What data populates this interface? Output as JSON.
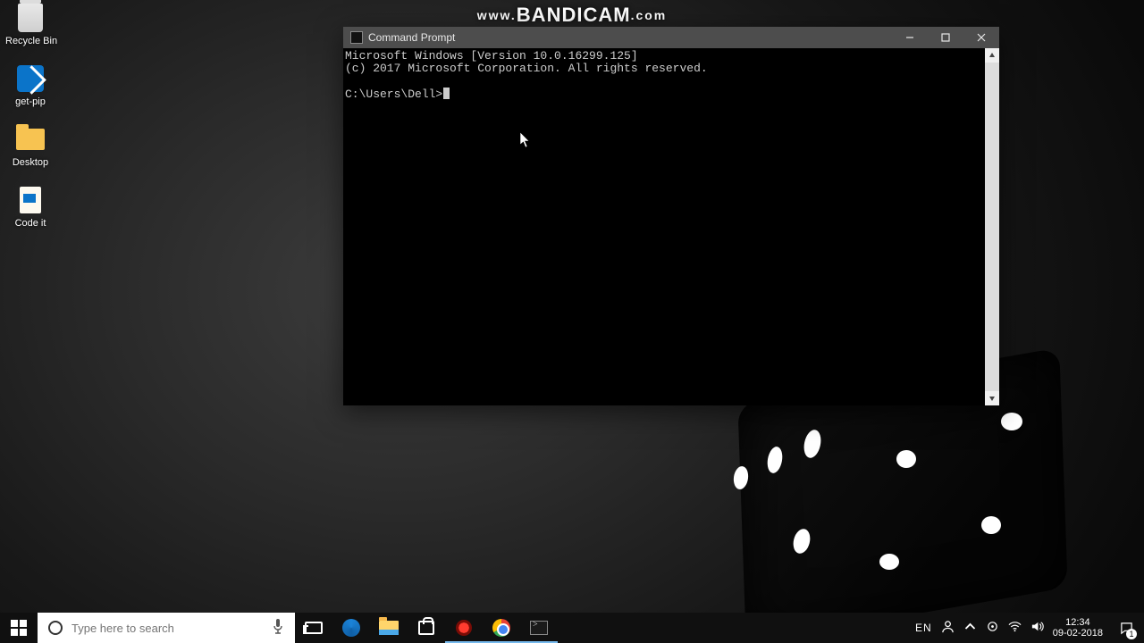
{
  "watermark": {
    "prefix": "www.",
    "brand": "BANDICAM",
    "suffix": ".com"
  },
  "desktop_icons": [
    {
      "name": "recycle-bin",
      "label": "Recycle Bin",
      "shape": "ic-bin"
    },
    {
      "name": "get-pip",
      "label": "get-pip",
      "shape": "ic-vs"
    },
    {
      "name": "desktop",
      "label": "Desktop",
      "shape": "ic-folder"
    },
    {
      "name": "code-it",
      "label": "Code it",
      "shape": "ic-file"
    }
  ],
  "cmd_window": {
    "title": "Command Prompt",
    "lines": [
      "Microsoft Windows [Version 10.0.16299.125]",
      "(c) 2017 Microsoft Corporation. All rights reserved.",
      "",
      "C:\\Users\\Dell>"
    ]
  },
  "taskbar": {
    "search_placeholder": "Type here to search",
    "apps": [
      {
        "name": "task-view",
        "shape": "ic-taskview",
        "running": false
      },
      {
        "name": "microsoft-edge",
        "shape": "ic-edge",
        "running": false
      },
      {
        "name": "file-explorer",
        "shape": "ic-explorer",
        "running": false
      },
      {
        "name": "microsoft-store",
        "shape": "ic-store",
        "running": false
      },
      {
        "name": "bandicam",
        "shape": "ic-rec",
        "running": true
      },
      {
        "name": "google-chrome",
        "shape": "ic-chrome",
        "running": true
      },
      {
        "name": "command-prompt",
        "shape": "ic-cmd",
        "running": true
      }
    ],
    "tray": {
      "language": "EN",
      "time": "12:34",
      "date": "09-02-2018",
      "notification_count": "1"
    }
  }
}
